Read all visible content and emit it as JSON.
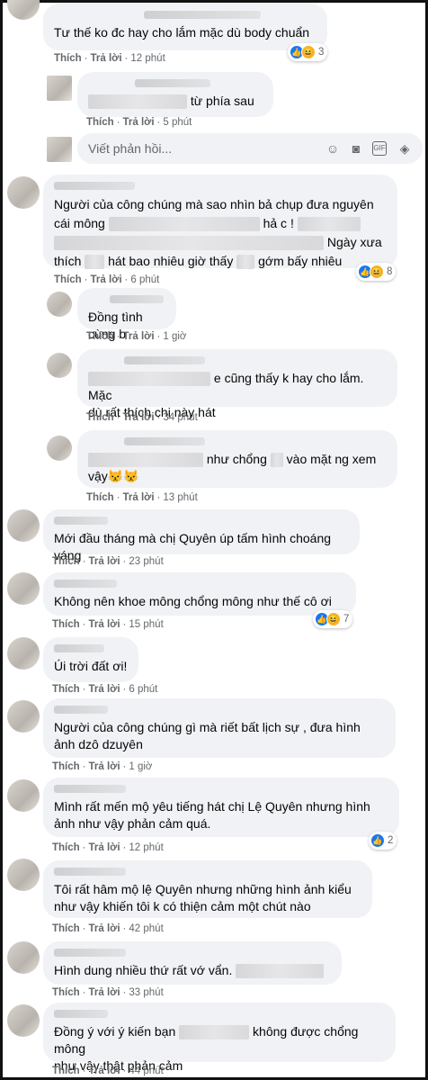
{
  "actions": {
    "like": "Thích",
    "reply": "Trả lời",
    "sep": "·"
  },
  "reply_box": {
    "placeholder": "Viết phản hồi..."
  },
  "comments": [
    {
      "text": "Tư thế ko đc hay cho lắm mặc dù body chuẩn",
      "time": "12 phút",
      "reactions": {
        "count": "3"
      }
    },
    {
      "text_after": "từ phía sau",
      "time": "5 phút"
    },
    {
      "line1_start": "Người của công chúng mà sao nhìn bả chụp đưa nguyên",
      "line2_start": "cái mông",
      "line2_mid": "hả c !",
      "line3_end": "Ngày xưa",
      "line4_start": "thích",
      "line4_mid": "hát bao nhiêu giờ thấy",
      "line4_end": "gớm bấy nhiêu",
      "time": "6 phút",
      "reactions": {
        "count": "8"
      }
    },
    {
      "text": "Đồng tình cùng b",
      "time": "1 giờ"
    },
    {
      "line1_after": "e cũng thấy k hay cho lắm. Mặc",
      "line2": "dù rất thích chị này hát",
      "time": "34 phút"
    },
    {
      "line1_after": "như chổng",
      "line1_end": "vào mặt ng xem",
      "line2": "vậy😾😾",
      "time": "13 phút"
    },
    {
      "text": "Mới đầu tháng mà chị Quyên úp tấm hình choáng váng",
      "time": "23 phút"
    },
    {
      "text": "Không nên khoe mông chổng mông như thế cô ơi",
      "time": "15 phút",
      "reactions": {
        "count": "7"
      }
    },
    {
      "text": "Úi trời đất ơi!",
      "time": "6 phút"
    },
    {
      "line1": "Người của công chúng gì mà riết bất lịch sự , đưa hình",
      "line2": "ảnh dzô dzuyên",
      "time": "1 giờ"
    },
    {
      "line1": "Mình rất mến mộ yêu tiếng hát chị Lệ Quyên nhưng hình",
      "line2": "ảnh như vậy phản cảm quá.",
      "time": "12 phút",
      "reactions": {
        "count": "2"
      }
    },
    {
      "line1": "Tôi rất hâm mộ lệ Quyên nhưng những hình ảnh kiểu",
      "line2": "như vậy khiến tôi k có thiện cảm một chút nào",
      "time": "42 phút"
    },
    {
      "text": "Hình dung nhiều thứ rất vớ vẩn.",
      "time": "33 phút"
    },
    {
      "line1_start": "Đồng ý với ý kiến bạn",
      "line1_end": "không được chổng mông",
      "line2": "như vậy thật phản cảm",
      "time": "44 phút"
    }
  ]
}
